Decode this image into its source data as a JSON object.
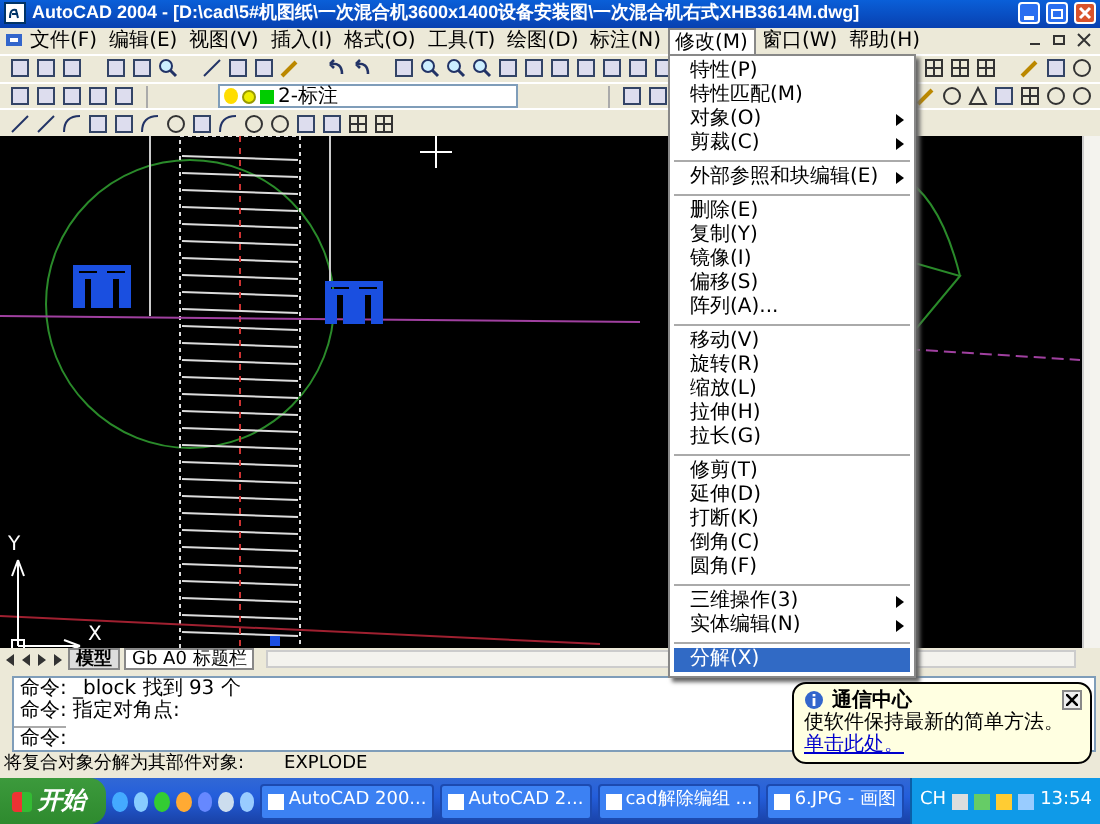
{
  "window": {
    "title": "AutoCAD 2004 - [D:\\cad\\5#机图纸\\一次混合机3600x1400设备安装图\\一次混合机右式XHB3614M.dwg]"
  },
  "menubar": [
    {
      "label": "文件(F)",
      "selected": false
    },
    {
      "label": "编辑(E)",
      "selected": false
    },
    {
      "label": "视图(V)",
      "selected": false
    },
    {
      "label": "插入(I)",
      "selected": false
    },
    {
      "label": "格式(O)",
      "selected": false
    },
    {
      "label": "工具(T)",
      "selected": false
    },
    {
      "label": "绘图(D)",
      "selected": false
    },
    {
      "label": "标注(N)",
      "selected": false
    },
    {
      "label": "修改(M)",
      "selected": true
    },
    {
      "label": "窗口(W)",
      "selected": false
    },
    {
      "label": "帮助(H)",
      "selected": false
    }
  ],
  "layer_combo": {
    "value": "2-标注"
  },
  "dropdown": [
    {
      "kind": "item",
      "label": "特性(P)",
      "submenu": false,
      "selected": false
    },
    {
      "kind": "item",
      "label": "特性匹配(M)",
      "submenu": false,
      "selected": false
    },
    {
      "kind": "item",
      "label": "对象(O)",
      "submenu": true,
      "selected": false
    },
    {
      "kind": "item",
      "label": "剪裁(C)",
      "submenu": true,
      "selected": false
    },
    {
      "kind": "separator"
    },
    {
      "kind": "item",
      "label": "外部参照和块编辑(E)",
      "submenu": true,
      "selected": false
    },
    {
      "kind": "separator"
    },
    {
      "kind": "item",
      "label": "删除(E)",
      "submenu": false,
      "selected": false
    },
    {
      "kind": "item",
      "label": "复制(Y)",
      "submenu": false,
      "selected": false
    },
    {
      "kind": "item",
      "label": "镜像(I)",
      "submenu": false,
      "selected": false
    },
    {
      "kind": "item",
      "label": "偏移(S)",
      "submenu": false,
      "selected": false
    },
    {
      "kind": "item",
      "label": "阵列(A)...",
      "submenu": false,
      "selected": false
    },
    {
      "kind": "separator"
    },
    {
      "kind": "item",
      "label": "移动(V)",
      "submenu": false,
      "selected": false
    },
    {
      "kind": "item",
      "label": "旋转(R)",
      "submenu": false,
      "selected": false
    },
    {
      "kind": "item",
      "label": "缩放(L)",
      "submenu": false,
      "selected": false
    },
    {
      "kind": "item",
      "label": "拉伸(H)",
      "submenu": false,
      "selected": false
    },
    {
      "kind": "item",
      "label": "拉长(G)",
      "submenu": false,
      "selected": false
    },
    {
      "kind": "separator"
    },
    {
      "kind": "item",
      "label": "修剪(T)",
      "submenu": false,
      "selected": false
    },
    {
      "kind": "item",
      "label": "延伸(D)",
      "submenu": false,
      "selected": false
    },
    {
      "kind": "item",
      "label": "打断(K)",
      "submenu": false,
      "selected": false
    },
    {
      "kind": "item",
      "label": "倒角(C)",
      "submenu": false,
      "selected": false
    },
    {
      "kind": "item",
      "label": "圆角(F)",
      "submenu": false,
      "selected": false
    },
    {
      "kind": "separator"
    },
    {
      "kind": "item",
      "label": "三维操作(3)",
      "submenu": true,
      "selected": false
    },
    {
      "kind": "item",
      "label": "实体编辑(N)",
      "submenu": true,
      "selected": false
    },
    {
      "kind": "separator"
    },
    {
      "kind": "item",
      "label": "分解(X)",
      "submenu": false,
      "selected": true
    }
  ],
  "ucs": {
    "x_label": "X",
    "y_label": "Y"
  },
  "layout_tabs": [
    {
      "label": "模型",
      "selected": true
    },
    {
      "label": "Gb A0 标题栏",
      "selected": false
    }
  ],
  "command_lines": [
    "命令: _block 找到 93 个",
    "命令: 指定对角点:"
  ],
  "command_prompt": "命令:",
  "status_bar": {
    "hint": "将复合对象分解为其部件对象:",
    "command": "EXPLODE"
  },
  "balloon": {
    "title": "通信中心",
    "text": "使软件保持最新的简单方法。",
    "link": "单击此处。"
  },
  "taskbar": {
    "start": "开始",
    "tasks": [
      "AutoCAD 200...",
      "AutoCAD 2...",
      "cad解除编组 ...",
      "6.JPG - 画图"
    ],
    "language": "CH",
    "clock": "13:54"
  }
}
